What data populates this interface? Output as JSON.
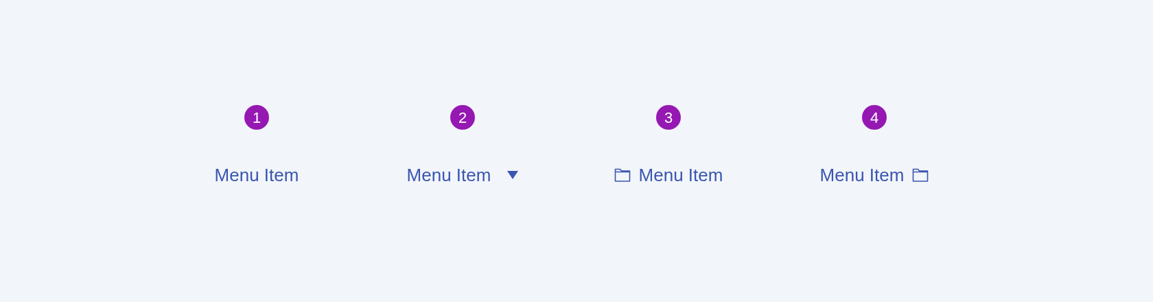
{
  "variants": [
    {
      "badge": "1",
      "label": "Menu Item",
      "kind": "plain"
    },
    {
      "badge": "2",
      "label": "Menu Item",
      "kind": "dropdown"
    },
    {
      "badge": "3",
      "label": "Menu Item",
      "kind": "icon-left"
    },
    {
      "badge": "4",
      "label": "Menu Item",
      "kind": "icon-right"
    }
  ]
}
